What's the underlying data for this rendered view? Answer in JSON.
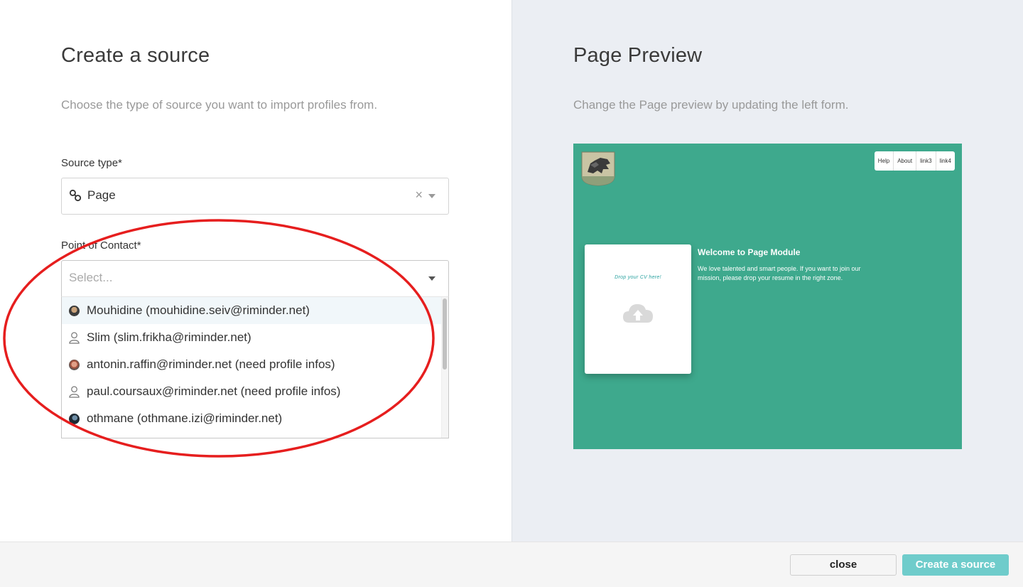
{
  "left": {
    "title": "Create a source",
    "description": "Choose the type of source you want to import profiles from.",
    "source_type": {
      "label": "Source type*",
      "value": "Page",
      "clear_symbol": "×"
    },
    "point_of_contact": {
      "label": "Point of Contact*",
      "placeholder": "Select...",
      "options": [
        {
          "label": "Mouhidine (mouhidine.seiv@riminder.net)",
          "icon": "avatar-photo"
        },
        {
          "label": "Slim (slim.frikha@riminder.net)",
          "icon": "user-outline-icon"
        },
        {
          "label": "antonin.raffin@riminder.net (need profile infos)",
          "icon": "avatar-photo"
        },
        {
          "label": "paul.coursaux@riminder.net (need profile infos)",
          "icon": "user-outline-icon"
        },
        {
          "label": "othmane (othmane.izi@riminder.net)",
          "icon": "avatar-photo"
        }
      ]
    }
  },
  "right": {
    "title": "Page Preview",
    "description": "Change the Page preview by updating the left form.",
    "preview": {
      "nav_links": [
        "Help",
        "About",
        "link3",
        "link4"
      ],
      "drop_text": "Drop your CV here!",
      "welcome_title": "Welcome to Page Module",
      "welcome_text": "We love talented and smart people. If you want to join our mission, please drop your resume in the right zone.",
      "background_color": "#3ea98d"
    }
  },
  "footer": {
    "close_label": "close",
    "create_label": "Create a source",
    "create_color": "#6fcccb"
  }
}
